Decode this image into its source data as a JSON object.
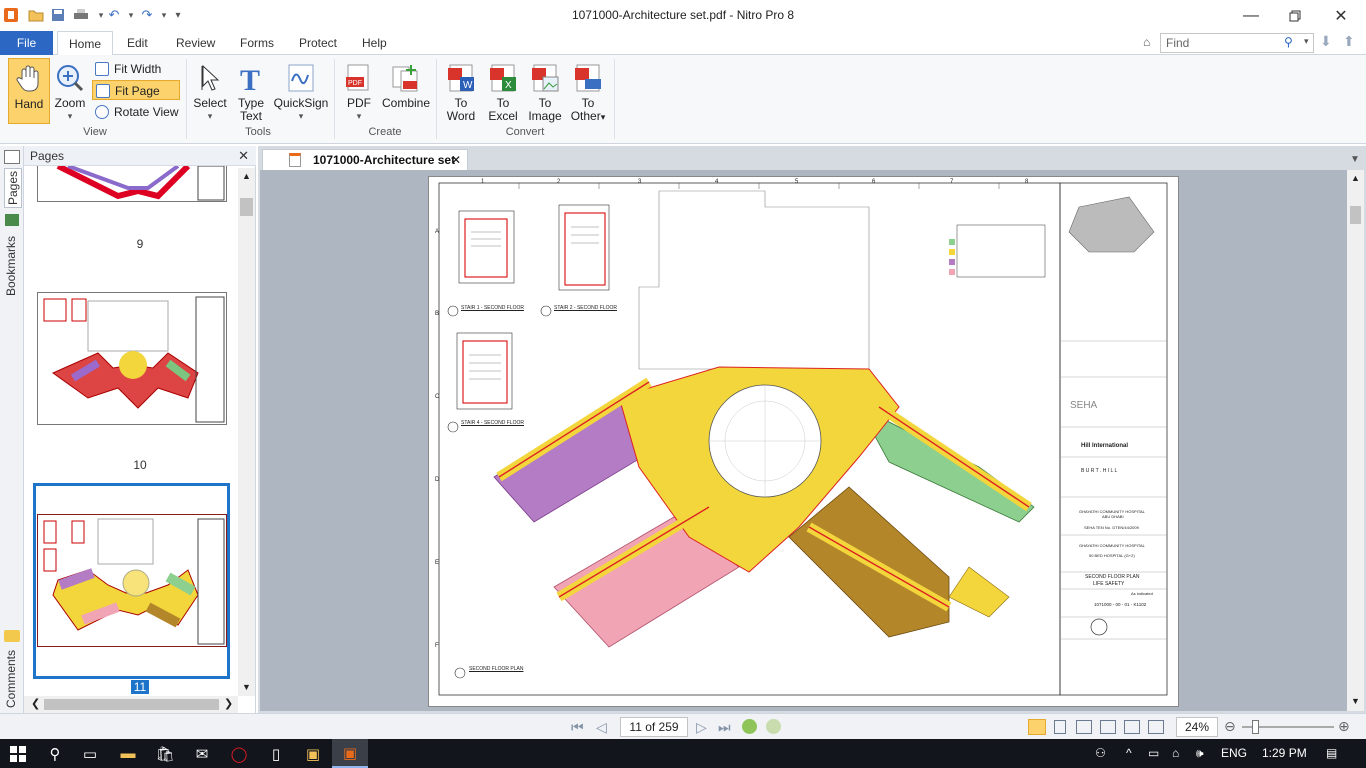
{
  "window": {
    "title": "1071000-Architecture set.pdf - Nitro Pro 8"
  },
  "menu": {
    "file": "File",
    "tabs": [
      "Home",
      "Edit",
      "Review",
      "Forms",
      "Protect",
      "Help"
    ],
    "find_placeholder": "Find"
  },
  "ribbon": {
    "view": {
      "hand": "Hand",
      "zoom": "Zoom",
      "fit_width": "Fit Width",
      "fit_page": "Fit Page",
      "rotate_view": "Rotate View",
      "group": "View"
    },
    "tools": {
      "select": "Select",
      "type_text": [
        "Type",
        "Text"
      ],
      "quicksign": "QuickSign",
      "group": "Tools"
    },
    "create": {
      "pdf": "PDF",
      "combine": "Combine",
      "group": "Create"
    },
    "convert": {
      "to_word": [
        "To",
        "Word"
      ],
      "to_excel": [
        "To",
        "Excel"
      ],
      "to_image": [
        "To",
        "Image"
      ],
      "to_other": [
        "To",
        "Other"
      ],
      "group": "Convert"
    }
  },
  "left_rail": {
    "pages": "Pages",
    "bookmarks": "Bookmarks",
    "comments": "Comments"
  },
  "pages_panel": {
    "title": "Pages",
    "thumbs": [
      {
        "num": "9"
      },
      {
        "num": "10"
      },
      {
        "num": "11"
      }
    ]
  },
  "document": {
    "tab_title": "1071000-Architecture set",
    "sheet": {
      "columns": [
        "1",
        "2",
        "3",
        "4",
        "5",
        "6",
        "7",
        "8"
      ],
      "rows": [
        "A",
        "B",
        "C",
        "D",
        "E",
        "F"
      ],
      "stair1": "STAIR 1 - SECOND FLOOR",
      "stair2": "STAIR 2 - SECOND FLOOR",
      "stair4": "STAIR 4 - SECOND FLOOR",
      "plan_title": "SECOND FLOOR PLAN",
      "tb_seha": "SEHA",
      "tb_hill": "Hill International",
      "tb_burt": "B U R T . H I L L",
      "tb_project": "GHAYATHI COMMUNITY HOSPITAL",
      "tb_abudhabi": "ABU DHABI",
      "tb_tender": "SEHA TEN No. GTEN/44/2009",
      "tb_project2": "GHAYATHI COMMUNITY HOSPITAL",
      "tb_bed": "50 BED HOSPITAL (G+2)",
      "tb_drawing_title": "SECOND FLOOR PLAN",
      "tb_drawing_sub": "LIFE SAFETY",
      "tb_scale": "As indicated",
      "tb_number": "1071000 - 00 - 01 - K1102"
    }
  },
  "status": {
    "page_display": "11 of 259",
    "zoom": "24%"
  },
  "taskbar": {
    "lang": "ENG",
    "time": "1:29 PM"
  },
  "colors": {
    "accent": "#2b67c3",
    "zone_purple": "#b37cc4",
    "zone_green": "#8dcf8f",
    "zone_pink": "#f0a4b4",
    "zone_brown": "#b4862a",
    "zone_yellow": "#f3d63b"
  }
}
